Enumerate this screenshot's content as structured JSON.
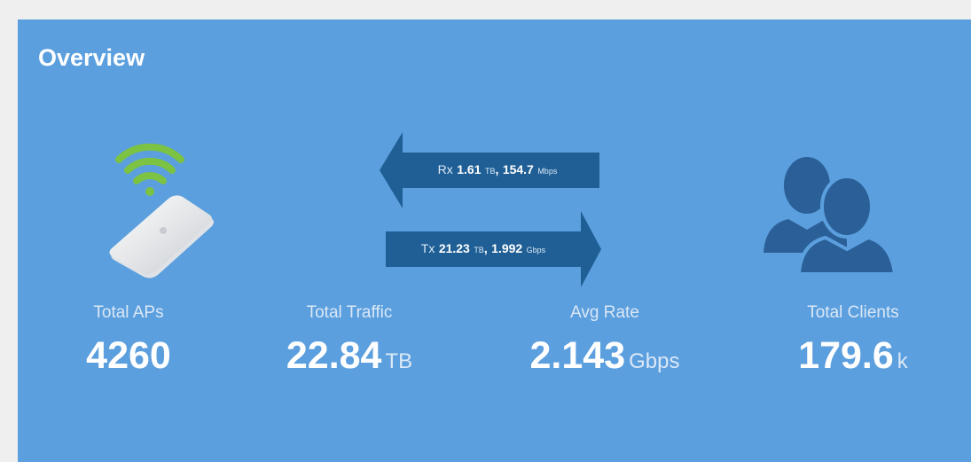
{
  "overview": {
    "title": "Overview",
    "rx": {
      "label": "Rx",
      "amount": "1.61",
      "amount_unit": "TB",
      "sep": ",",
      "rate": "154.7",
      "rate_unit": "Mbps"
    },
    "tx": {
      "label": "Tx",
      "amount": "21.23",
      "amount_unit": "TB",
      "sep": ",",
      "rate": "1.992",
      "rate_unit": "Gbps"
    },
    "stats": {
      "total_aps": {
        "label": "Total APs",
        "value": "4260",
        "unit": ""
      },
      "total_traffic": {
        "label": "Total Traffic",
        "value": "22.84",
        "unit": "TB"
      },
      "avg_rate": {
        "label": "Avg Rate",
        "value": "2.143",
        "unit": "Gbps"
      },
      "total_clients": {
        "label": "Total Clients",
        "value": "179.6",
        "unit": "k"
      }
    }
  },
  "icons": {
    "access_point": "wifi-access-point-icon",
    "clients": "users-icon"
  },
  "colors": {
    "card": "#5b9fde",
    "arrow": "#1f5f95",
    "wifi": "#7cc243",
    "clients_icon": "#2b5f97"
  }
}
